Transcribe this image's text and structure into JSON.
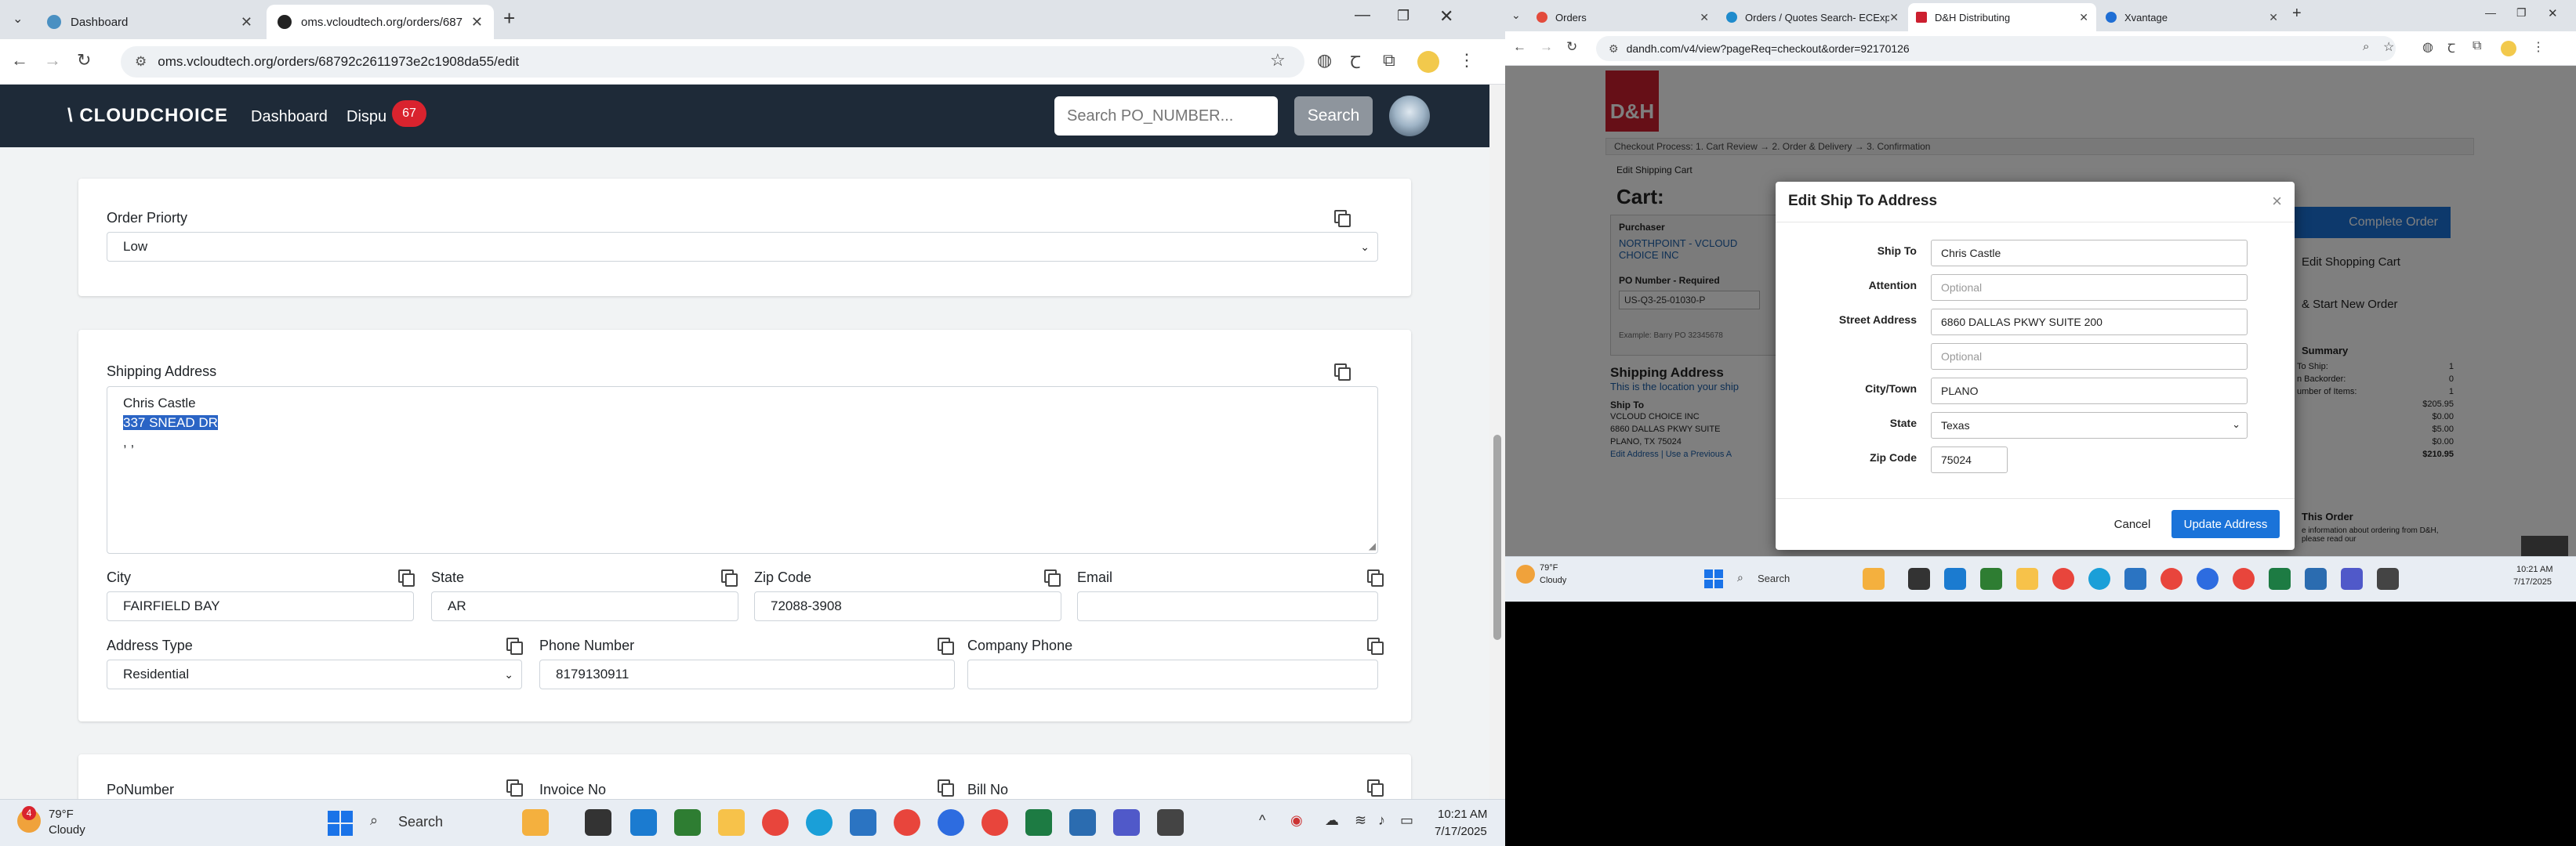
{
  "left_browser": {
    "tabs": [
      {
        "title": "Dashboard",
        "active": false
      },
      {
        "title": "oms.vcloudtech.org/orders/687",
        "active": true
      }
    ],
    "new_tab_label": "+",
    "url": "oms.vcloudtech.org/orders/68792c2611973e2c1908da55/edit"
  },
  "app": {
    "logo": "\\ CLOUDCHOICE",
    "nav": {
      "dashboard": "Dashboard",
      "disputes": "Dispu",
      "disputes_badge": "67"
    },
    "search_placeholder": "Search PO_NUMBER...",
    "search_button": "Search"
  },
  "order_form": {
    "order_priority_label": "Order Priorty",
    "order_priority_value": "Low",
    "shipping_address_label": "Shipping Address",
    "shipping_address_lines": [
      "Chris Castle",
      "337 SNEAD DR",
      ", ,"
    ],
    "city_label": "City",
    "city_value": "FAIRFIELD BAY",
    "state_label": "State",
    "state_value": "AR",
    "zip_label": "Zip Code",
    "zip_value": "72088-3908",
    "email_label": "Email",
    "email_value": "",
    "address_type_label": "Address Type",
    "address_type_value": "Residential",
    "phone_label": "Phone Number",
    "phone_value": "8179130911",
    "company_phone_label": "Company Phone",
    "company_phone_value": "",
    "ponumber_label": "PoNumber",
    "invoice_label": "Invoice No",
    "bill_label": "Bill No"
  },
  "taskbar_left": {
    "weather_temp": "79°F",
    "weather_desc": "Cloudy",
    "weather_badge": "4",
    "search": "Search",
    "time": "10:21 AM",
    "date": "7/17/2025"
  },
  "right_browser": {
    "tabs": [
      {
        "title": "Orders",
        "active": false
      },
      {
        "title": "Orders / Quotes Search- ECExp",
        "active": false
      },
      {
        "title": "D&H Distributing",
        "active": true
      },
      {
        "title": "Xvantage",
        "active": false
      }
    ],
    "url": "dandh.com/v4/view?pageReq=checkout&order=92170126"
  },
  "dh_page": {
    "logo": "D&H",
    "breadcrumb": "Checkout Process:  1. Cart Review  →  2. Order & Delivery  →  3. Confirmation",
    "edit_cart_link": "Edit Shipping Cart",
    "cart_title": "Cart:",
    "purchaser_label": "Purchaser",
    "purchaser_value": "NORTHPOINT - VCLOUD CHOICE INC",
    "po_label": "PO Number - Required",
    "po_value": "US-Q3-25-01030-P",
    "po_example": "Example: Barry PO 32345678",
    "shipping_heading": "Shipping Address",
    "shipping_sub": "This is the location your ship",
    "ship_to_label": "Ship To",
    "ship_to_lines": [
      "VCLOUD CHOICE INC",
      "6860 DALLAS PKWY SUITE",
      "PLANO, TX 75024"
    ],
    "edit_links": "Edit Address | Use a Previous A",
    "complete_order": "Complete Order",
    "edit_shopping_cart": "Edit Shopping Cart",
    "save_start": "& Start New Order",
    "summary_title": "Summary",
    "summary_rows": [
      {
        "label": "To Ship:",
        "value": "1"
      },
      {
        "label": "n Backorder:",
        "value": "0"
      },
      {
        "label": "umber of Items:",
        "value": "1"
      },
      {
        "label": "",
        "value": "$205.95"
      },
      {
        "label": "",
        "value": "$0.00"
      },
      {
        "label": "",
        "value": "$5.00"
      },
      {
        "label": "",
        "value": "$0.00"
      },
      {
        "label": "",
        "value": "$210.95"
      }
    ],
    "this_order": "This Order",
    "info_text": "e information about ordering from D&H, please read our"
  },
  "modal": {
    "title": "Edit Ship To Address",
    "close": "×",
    "ship_to_label": "Ship To",
    "ship_to_value": "Chris Castle",
    "attention_label": "Attention",
    "attention_placeholder": "Optional",
    "street_label": "Street Address",
    "street_value": "6860 DALLAS PKWY SUITE 200",
    "street2_placeholder": "Optional",
    "city_label": "City/Town",
    "city_value": "PLANO",
    "state_label": "State",
    "state_value": "Texas",
    "zip_label": "Zip Code",
    "zip_value": "75024",
    "cancel": "Cancel",
    "update": "Update Address"
  },
  "taskbar_right": {
    "weather_temp": "79°F",
    "weather_desc": "Cloudy",
    "search": "Search",
    "time": "10:21 AM",
    "date": "7/17/2025"
  }
}
